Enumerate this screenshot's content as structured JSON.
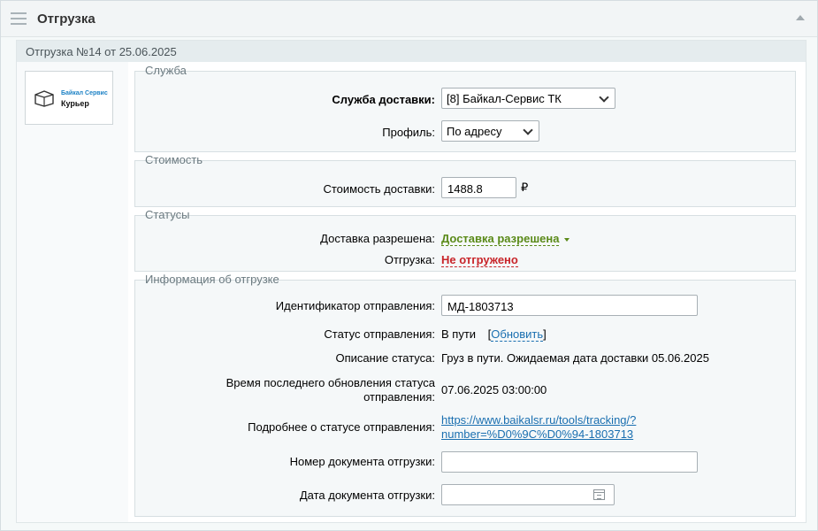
{
  "panel": {
    "title": "Отгрузка"
  },
  "shipment": {
    "header": "Отгрузка №14 от 25.06.2025"
  },
  "logo": {
    "brand": "Байкал Сервис",
    "subtitle": "Курьер"
  },
  "service_section": {
    "legend": "Служба",
    "delivery_service_label": "Служба доставки:",
    "delivery_service_value": "[8] Байкал-Сервис ТК",
    "profile_label": "Профиль:",
    "profile_value": "По адресу"
  },
  "cost_section": {
    "legend": "Стоимость",
    "cost_label": "Стоимость доставки:",
    "cost_value": "1488.8",
    "currency": "₽"
  },
  "status_section": {
    "legend": "Статусы",
    "delivery_allowed_label": "Доставка разрешена:",
    "delivery_allowed_value": "Доставка разрешена",
    "shipment_label": "Отгрузка:",
    "shipment_value": "Не отгружено"
  },
  "info_section": {
    "legend": "Информация об отгрузке",
    "tracking_id_label": "Идентификатор отправления:",
    "tracking_id_value": "МД-1803713",
    "tracking_status_label": "Статус отправления:",
    "tracking_status_value": "В пути",
    "refresh_open": "[",
    "refresh_link": "Обновить",
    "refresh_close": "]",
    "status_description_label": "Описание статуса:",
    "status_description_value": "Груз в пути. Ожидаемая дата доставки 05.06.2025",
    "last_update_label_line1": "Время последнего обновления статуса",
    "last_update_label_line2": "отправления:",
    "last_update_value": "07.06.2025 03:00:00",
    "details_label": "Подробнее о статусе отправления:",
    "details_link_line1": "https://www.baikalsr.ru/tools/tracking/?",
    "details_link_line2": "number=%D0%9C%D0%94-1803713",
    "doc_number_label": "Номер документа отгрузки:",
    "doc_number_value": "",
    "doc_date_label": "Дата документа отгрузки:",
    "doc_date_value": ""
  },
  "icons": {
    "menu": "hamburger-icon",
    "collapse": "collapse-up-icon",
    "calendar": "calendar-icon",
    "package": "box-icon"
  },
  "colors": {
    "status_ok": "#5a8a18",
    "status_bad": "#c8252a",
    "link": "#1a6fb0"
  }
}
